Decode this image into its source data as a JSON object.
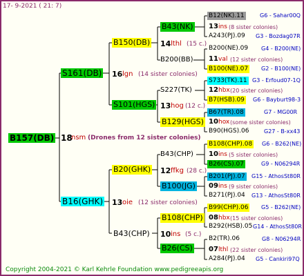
{
  "header": "17-  9-2021  ( 21:  7)",
  "footer": "Copyright 2004-2021 © Karl Kehrle Foundation    www.pedigreeapis.org",
  "root": {
    "name": "B157(DB)",
    "num": "18",
    "code": "nsm",
    "note": "(Drones from 12 sister colonies)"
  },
  "gen1": {
    "upper": {
      "name": "S161(DB)",
      "num": "16",
      "code": "lgn",
      "note": "(14 sister colonies)"
    },
    "lower": {
      "name": "B16(GHK)",
      "num": "13",
      "code": "oie",
      "note": "(12 sister colonies)"
    }
  },
  "gen2": {
    "a": {
      "name": "B150(DB)",
      "num": "14",
      "code": "lthl",
      "note": "(15 c.)"
    },
    "b": {
      "name": "S101(HGS)",
      "num": "13",
      "code": "hog",
      "note": "(12 c.)"
    },
    "c": {
      "name": "B20(GHK)",
      "num": "12",
      "code": "ffkg",
      "note": "(28 c.)"
    },
    "d": {
      "name": "B43(CHP)",
      "num": "10",
      "code": "ins",
      "note": "(5 c.)"
    }
  },
  "gen3": {
    "a1": "B43(NK)",
    "a2": "B200(BB)",
    "b1": "S227(TK)",
    "b2": "B129(HGS)",
    "c1": "B43(CHP)",
    "c2": "B100(JG)",
    "d1": "B108(CHP)",
    "d2": "B26(CS)"
  },
  "gen4": [
    {
      "name": "B12(NK).11",
      "pedigree": "G6 - Sahar00Q"
    },
    {
      "num": "13",
      "code": "ins",
      "note": "(8 sister colonies)"
    },
    {
      "name": "A243(PJ).09",
      "pedigree": "G3 - Bozdag07R"
    },
    {
      "name": "B200(NE).09",
      "pedigree": "G4 - B200(NE)"
    },
    {
      "num": "11",
      "code": "val",
      "note": "(12 sister colonies)"
    },
    {
      "name": "B100(NE).07",
      "pedigree": "G2 - B100(NE)"
    },
    {
      "name": "S733(TK).11",
      "pedigree": "G3 - Erfoud07-1Q"
    },
    {
      "num": "12",
      "code": "hbx",
      "note": "(20 sister colonies)"
    },
    {
      "name": "B7(HSB).09",
      "pedigree": "G6 - Bayburt98-3"
    },
    {
      "name": "B67(TR).08",
      "pedigree": "G7 - MG00R"
    },
    {
      "num": "10",
      "code": "hox",
      "note": "(some sister colonies)"
    },
    {
      "name": "B90(HGS).06",
      "pedigree": "G27 - B-xx43"
    },
    {
      "name": "B108(CHP).08",
      "pedigree": "G6 - B262(NE)"
    },
    {
      "num": "10",
      "code": "ins",
      "note": "(5 sister colonies)"
    },
    {
      "name": "B26(CS).07",
      "pedigree": "G9 - N06294R"
    },
    {
      "name": "B201(PJ).07",
      "pedigree": "G15 - AthosSt80R"
    },
    {
      "num": "09",
      "code": "ins",
      "note": "(9 sister colonies)"
    },
    {
      "name": "B271(PJ).04",
      "pedigree": "G13 - AthosSt80R"
    },
    {
      "name": "B99(CHP).06",
      "pedigree": "G5 - B262(NE)"
    },
    {
      "num": "08",
      "code": "hbx",
      "note": "(15 sister colonies)"
    },
    {
      "name": "B292(HSB).05",
      "pedigree": "G14 - AthosSt80R"
    },
    {
      "name": "B2(TR).06",
      "pedigree": "G8 - N06294R"
    },
    {
      "num": "07",
      "code": "lthl",
      "note": "(22 sister colonies)"
    },
    {
      "name": "A284(PJ).04",
      "pedigree": "G5 - Cankiri97Q"
    }
  ],
  "colors": {
    "frame": "#8a2a6a",
    "green": "#00c800",
    "yellow": "#ffff00",
    "cyan": "#00ffff",
    "blue": "#0000c0",
    "red": "#c00000"
  }
}
